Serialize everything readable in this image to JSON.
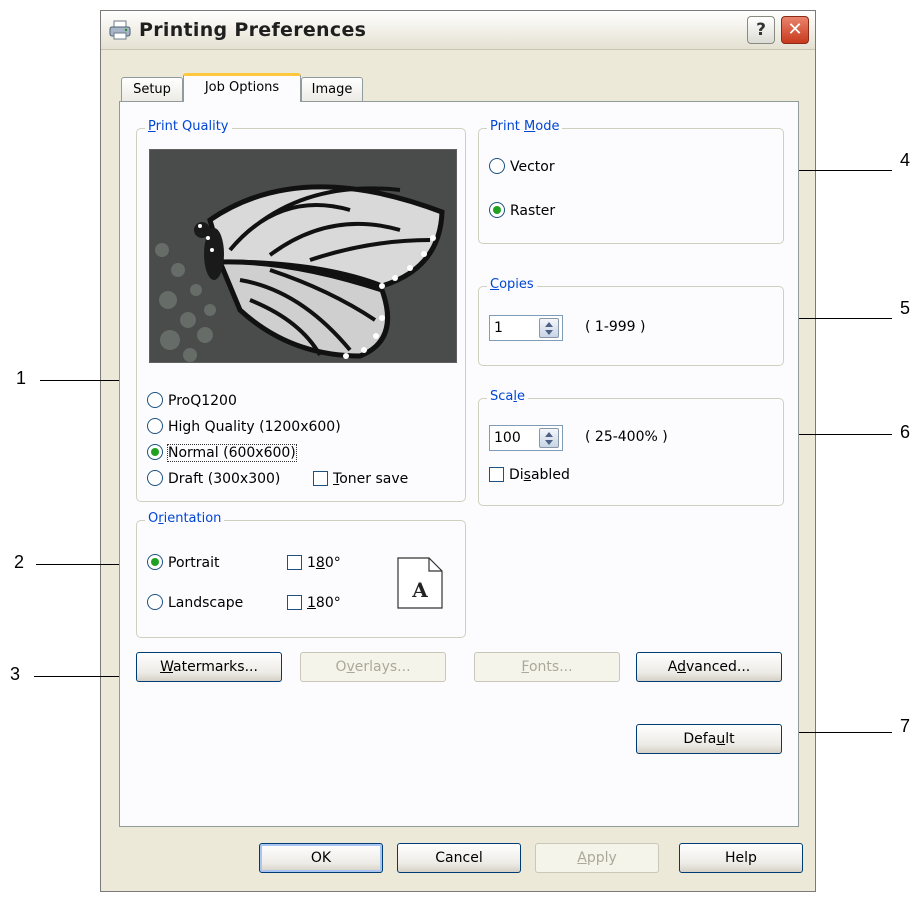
{
  "window": {
    "title": "Printing Preferences",
    "help_label": "?",
    "close_label": "✕"
  },
  "tabs": [
    {
      "label": "Setup",
      "active": false
    },
    {
      "label": "Job Options",
      "active": true
    },
    {
      "label": "Image",
      "active": false
    }
  ],
  "print_quality": {
    "label_underline": "P",
    "label_rest": "rint Quality",
    "options": [
      {
        "label": "ProQ1200",
        "selected": false
      },
      {
        "label": "High Quality (1200x600)",
        "selected": false
      },
      {
        "label": "Normal (600x600)",
        "selected": true
      },
      {
        "label": "Draft (300x300)",
        "selected": false
      }
    ],
    "toner_save_underline": "T",
    "toner_save_rest": "oner save",
    "toner_save_checked": false
  },
  "orientation": {
    "label_pre": "O",
    "label_underline": "r",
    "label_rest": "ientation",
    "portrait_label": "Portrait",
    "portrait_selected": true,
    "landscape_label": "Landscape",
    "landscape_selected": false,
    "rotate1_pre": "1",
    "rotate1_underline": "8",
    "rotate1_rest": "0°",
    "rotate2_underline": "1",
    "rotate2_rest": "80°",
    "doc_icon_letter": "A"
  },
  "print_mode": {
    "label_pre": "Print ",
    "label_underline": "M",
    "label_rest": "ode",
    "options": [
      {
        "label": "Vector",
        "selected": false
      },
      {
        "label": "Raster",
        "selected": true
      }
    ]
  },
  "copies": {
    "label_underline": "C",
    "label_rest": "opies",
    "value": "1",
    "range": "( 1-999 )"
  },
  "scale": {
    "label_pre": "Sca",
    "label_underline": "l",
    "label_rest": "e",
    "value": "100",
    "range": "( 25-400% )",
    "disabled_pre": "Di",
    "disabled_underline": "s",
    "disabled_rest": "abled",
    "disabled_checked": false
  },
  "buttons": {
    "watermarks_underline": "W",
    "watermarks_rest": "atermarks...",
    "overlays_pre": "O",
    "overlays_underline": "v",
    "overlays_rest": "erlays...",
    "fonts_underline": "F",
    "fonts_rest": "onts...",
    "advanced_pre": "A",
    "advanced_underline": "d",
    "advanced_rest": "vanced...",
    "default_pre": "Defa",
    "default_underline": "u",
    "default_rest": "lt",
    "ok": "OK",
    "cancel": "Cancel",
    "apply_underline": "A",
    "apply_rest": "pply",
    "help": "Help"
  },
  "callouts": [
    "1",
    "2",
    "3",
    "4",
    "5",
    "6",
    "7"
  ],
  "icons": {
    "printer": "printer-icon",
    "spin": "spin-arrows-icon",
    "document": "document-icon",
    "butterfly": "butterfly-preview-image"
  }
}
